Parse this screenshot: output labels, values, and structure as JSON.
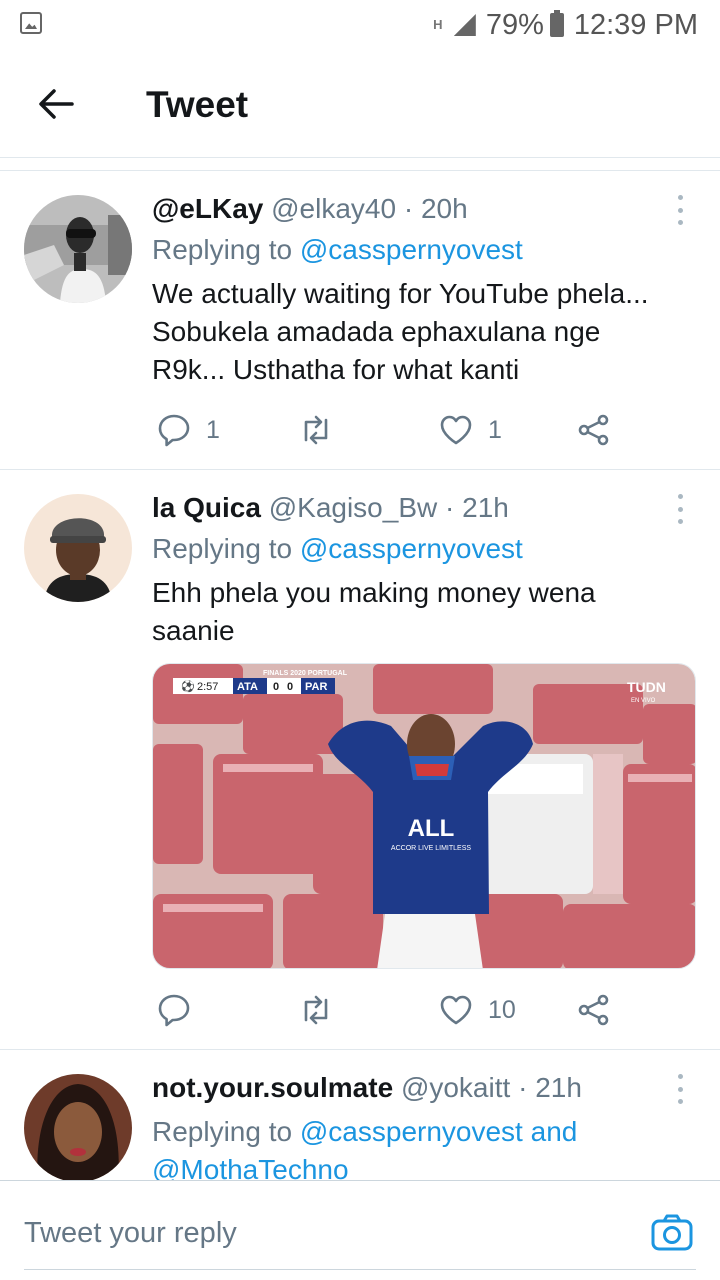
{
  "status_bar": {
    "network": "H",
    "battery": "79%",
    "time": "12:39 PM"
  },
  "header": {
    "title": "Tweet"
  },
  "tweets": [
    {
      "display_name": "@eLKay",
      "handle": "@elkay40",
      "time": "20h",
      "replying_prefix": "Replying to",
      "replying_to": "@casspernyovest",
      "text_lines": [
        "We actually waiting for YouTube phela...",
        "Sobukela amadada ephaxulana nge",
        "R9k... Usthatha for what kanti"
      ],
      "reply_count": "1",
      "retweet_count": "",
      "like_count": "1"
    },
    {
      "display_name": "la Quica",
      "handle": "@Kagiso_Bw",
      "time": "21h",
      "replying_prefix": "Replying to",
      "replying_to": "@casspernyovest",
      "text_lines": [
        "Ehh phela you making money wena",
        "saanie"
      ],
      "media": {
        "scoreboard": {
          "clock": "2:57",
          "home": "ATA",
          "home_score": "0",
          "away_score": "0",
          "away": "PAR",
          "banner": "FINALS 2020 PORTUGAL"
        },
        "broadcaster": "TUDN",
        "broadcaster_sub": "EN VIVO",
        "shirt_text": "ALL",
        "shirt_subtext": "ACCOR LIVE LIMITLESS"
      },
      "reply_count": "",
      "retweet_count": "",
      "like_count": "10"
    },
    {
      "display_name": "not.your.soulmate",
      "handle": "@yokaitt",
      "time": "21h",
      "replying_prefix": "Replying to",
      "replying_to": "@casspernyovest and",
      "replying_to_2": "@MothaTechno"
    }
  ],
  "composer": {
    "placeholder": "Tweet your reply"
  },
  "colors": {
    "link": "#1b95e0",
    "muted": "#657786",
    "text": "#14171a",
    "divider": "#e1e8ed"
  }
}
